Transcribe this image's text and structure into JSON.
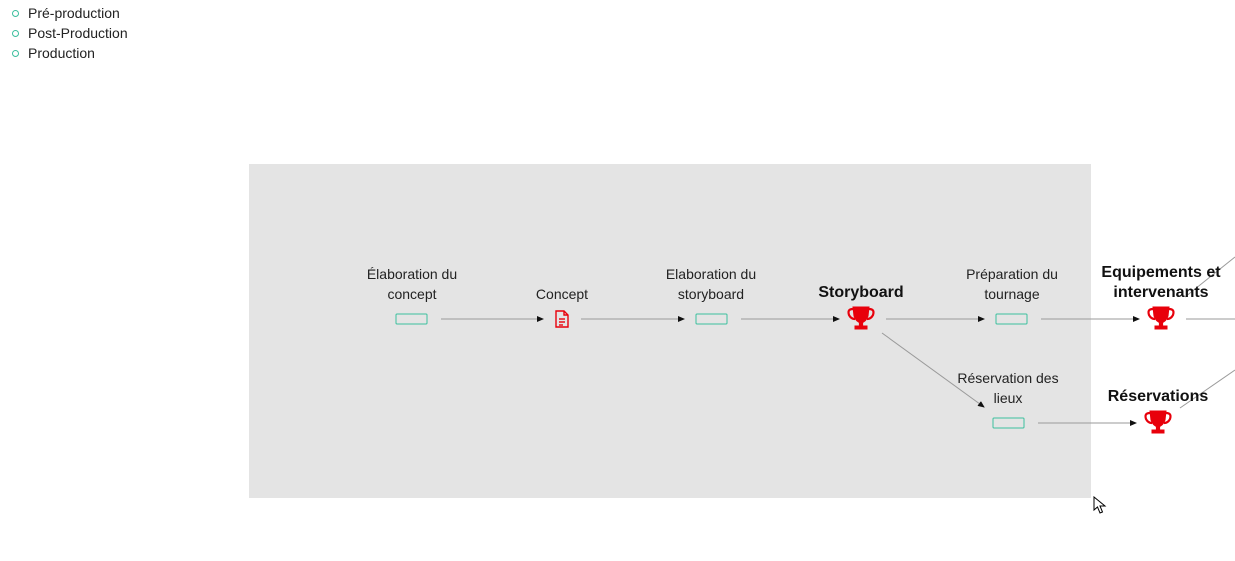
{
  "legend": {
    "items": [
      {
        "label": "Pré-production"
      },
      {
        "label": "Post-Production"
      },
      {
        "label": "Production"
      }
    ]
  },
  "nodes": {
    "elaboration_concept": {
      "label": "Élaboration du concept",
      "type": "task"
    },
    "concept": {
      "label": "Concept",
      "type": "document"
    },
    "elaboration_storyboard": {
      "label": "Elaboration du storyboard",
      "type": "task"
    },
    "storyboard": {
      "label": "Storyboard",
      "type": "milestone"
    },
    "preparation_tournage": {
      "label": "Préparation du tournage",
      "type": "task"
    },
    "equipements": {
      "label": "Equipements et intervenants",
      "type": "milestone"
    },
    "reservation_lieux": {
      "label": "Réservation des lieux",
      "type": "task"
    },
    "reservations": {
      "label": "Réservations",
      "type": "milestone"
    }
  },
  "colors": {
    "task_border": "#3cbf9e",
    "milestone": "#e8000b",
    "document": "#e8000b",
    "edge": "#9a9a9a",
    "canvas_bg": "#e4e4e4"
  },
  "icons": {
    "milestone": "trophy-icon",
    "document": "document-icon",
    "task": "task-box",
    "cursor": "mouse-pointer-icon"
  }
}
